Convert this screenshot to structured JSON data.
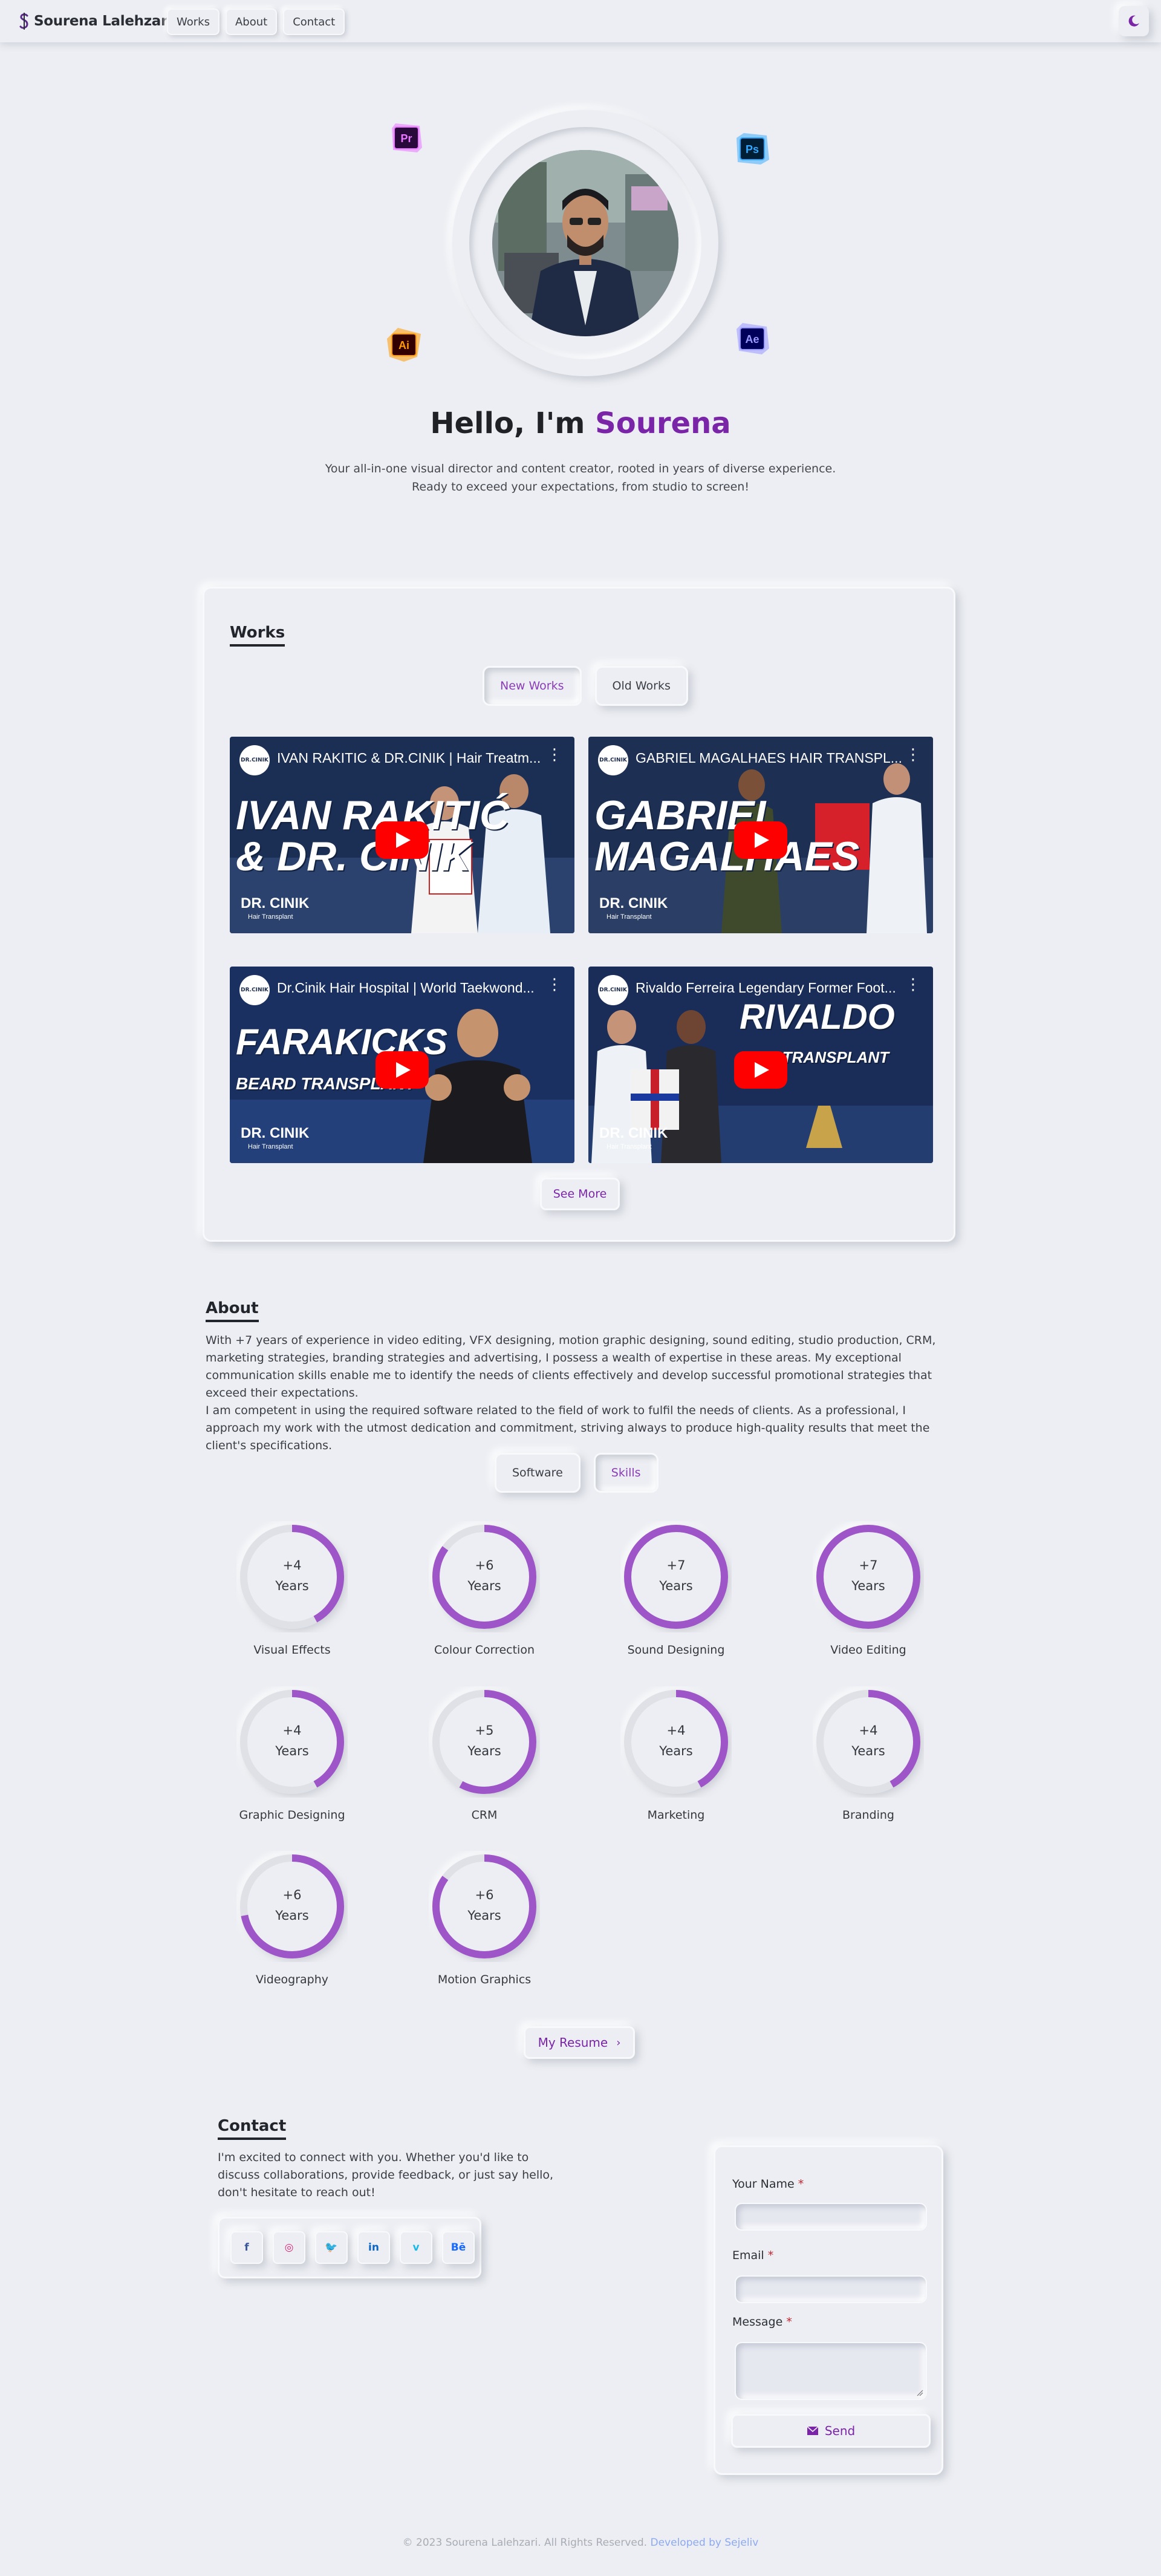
{
  "nav": {
    "brand": "Sourena Lalehzari",
    "links": [
      "Works",
      "About",
      "Contact"
    ],
    "theme_icon": "moon-icon"
  },
  "hero": {
    "greeting": "Hello, I'm",
    "name": "Sourena",
    "subtitle_line1": "Your all-in-one visual director and content creator, rooted in years of diverse experience.",
    "subtitle_line2": "Ready to exceed your expectations, from studio to screen!",
    "app_icons": [
      {
        "label": "Pr",
        "name": "premiere-pro-icon"
      },
      {
        "label": "Ps",
        "name": "photoshop-icon"
      },
      {
        "label": "Ai",
        "name": "illustrator-icon"
      },
      {
        "label": "Ae",
        "name": "after-effects-icon"
      }
    ]
  },
  "works": {
    "title": "Works",
    "tabs": [
      "New Works",
      "Old Works"
    ],
    "active_tab": "New Works",
    "videos": [
      {
        "title": "IVAN RAKITIC & DR.CINIK | Hair Treatm...",
        "headline1": "IVAN RAKITIĆ",
        "headline2": "& DR. CINIK",
        "brand": "DR. CINIK",
        "brand_sub": "Hair Transplant",
        "channel": "DR.CINIK"
      },
      {
        "title": "GABRIEL MAGALHAES HAIR TRANSPL...",
        "headline1": "GABRIEL",
        "headline2": "MAGALHAES",
        "brand": "DR. CINIK",
        "brand_sub": "Hair Transplant",
        "channel": "DR.CINIK"
      },
      {
        "title": "Dr.Cinik Hair Hospital | World Taekwond...",
        "headline1": "FARAKICKS",
        "headline2": "BEARD TRANSPLANT",
        "brand": "DR. CINIK",
        "brand_sub": "Hair Transplant",
        "channel": "DR.CINIK"
      },
      {
        "title": "Rivaldo Ferreira Legendary Former Foot...",
        "headline1": "RIVALDO",
        "headline2": "HAIR TRANSPLANT",
        "brand": "DR. CINIK",
        "brand_sub": "Hair Transplant",
        "channel": "DR.CINIK"
      }
    ],
    "see_more": "See More"
  },
  "about": {
    "title": "About",
    "paragraph1": "With +7 years of experience in video editing, VFX designing, motion graphic designing, sound editing, studio production, CRM, marketing strategies, branding strategies and advertising, I possess a wealth of expertise in these areas. My exceptional communication skills enable me to identify the needs of clients effectively and develop successful promotional strategies that exceed their expectations.",
    "paragraph2": "I am competent in using the required software related to the field of work to fulfil the needs of clients. As a professional, I approach my work with the utmost dedication and commitment, striving always to produce high-quality results that meet the client's specifications.",
    "tabs": [
      "Software",
      "Skills"
    ],
    "active_tab": "Skills",
    "skills": [
      {
        "name": "Visual Effects",
        "value": "+4",
        "unit": "Years",
        "fill": 0.42
      },
      {
        "name": "Colour Correction",
        "value": "+6",
        "unit": "Years",
        "fill": 0.85
      },
      {
        "name": "Sound Designing",
        "value": "+7",
        "unit": "Years",
        "fill": 1.0
      },
      {
        "name": "Video Editing",
        "value": "+7",
        "unit": "Years",
        "fill": 1.0
      },
      {
        "name": "Graphic Designing",
        "value": "+4",
        "unit": "Years",
        "fill": 0.42
      },
      {
        "name": "CRM",
        "value": "+5",
        "unit": "Years",
        "fill": 0.58
      },
      {
        "name": "Marketing",
        "value": "+4",
        "unit": "Years",
        "fill": 0.42
      },
      {
        "name": "Branding",
        "value": "+4",
        "unit": "Years",
        "fill": 0.42
      },
      {
        "name": "Videography",
        "value": "+6",
        "unit": "Years",
        "fill": 0.72
      },
      {
        "name": "Motion Graphics",
        "value": "+6",
        "unit": "Years",
        "fill": 0.85
      }
    ],
    "resume": "My Resume"
  },
  "contact": {
    "title": "Contact",
    "text": "I'm excited to connect with you. Whether you'd like to discuss collaborations, provide feedback, or just say hello, don't hesitate to reach out!",
    "socials": [
      {
        "label": "f",
        "name": "facebook-icon",
        "color": "#3b5998"
      },
      {
        "label": "◎",
        "name": "instagram-icon",
        "color": "#d62976"
      },
      {
        "label": "🐦",
        "name": "twitter-icon",
        "color": "#1da1f2"
      },
      {
        "label": "in",
        "name": "linkedin-icon",
        "color": "#0a66c2"
      },
      {
        "label": "v",
        "name": "vimeo-icon",
        "color": "#1ab7ea"
      },
      {
        "label": "Bē",
        "name": "behance-icon",
        "color": "#1769ff"
      }
    ],
    "form": {
      "name_label": "Your Name",
      "email_label": "Email",
      "message_label": "Message",
      "required_mark": "*",
      "send": "Send"
    }
  },
  "footer": {
    "copyright": "© 2023 Sourena Lalehzari. All Rights Reserved.",
    "developer": "Developed by Sejeliv"
  },
  "colors": {
    "background": "#eceef3",
    "accent": "#7a24a8",
    "ring": "#9d55c8"
  }
}
